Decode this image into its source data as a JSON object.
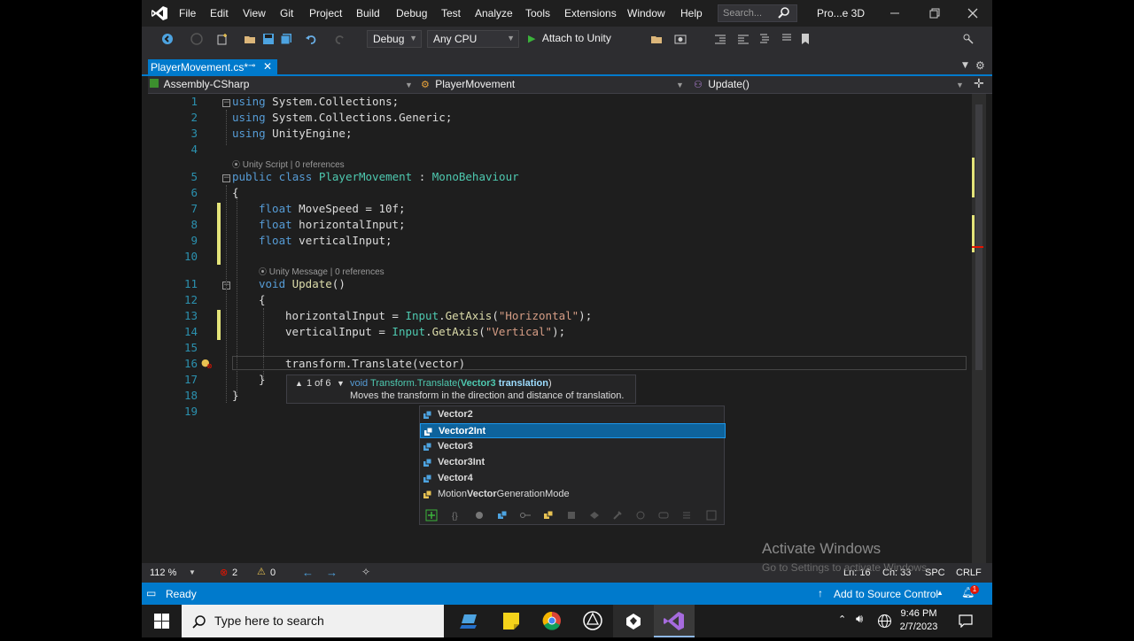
{
  "titlebar": {
    "menu": [
      "File",
      "Edit",
      "View",
      "Git",
      "Project",
      "Build",
      "Debug",
      "Test",
      "Analyze",
      "Tools",
      "Extensions",
      "Window",
      "Help"
    ],
    "search_placeholder": "Search...",
    "project_name": "Pro...e 3D"
  },
  "toolbar": {
    "config": "Debug",
    "platform": "Any CPU",
    "attach_label": "Attach to Unity"
  },
  "tab": {
    "label": "PlayerMovement.cs*"
  },
  "navbar": {
    "project": "Assembly-CSharp",
    "class": "PlayerMovement",
    "member": "Update()"
  },
  "editor": {
    "line_numbers": [
      "1",
      "2",
      "3",
      "4",
      "5",
      "6",
      "7",
      "8",
      "9",
      "10",
      "11",
      "12",
      "13",
      "14",
      "15",
      "16",
      "17",
      "18",
      "19"
    ],
    "lens_class": "Unity Script | 0 references",
    "lens_method": "Unity Message | 0 references",
    "lines": {
      "l1_kw": "using",
      "l1_rest": " System.Collections;",
      "l2_kw": "using",
      "l2_rest": " System.Collections.Generic;",
      "l3_kw": "using",
      "l3_rest": " UnityEngine;",
      "l5_kw": "public class",
      "l5_name": " PlayerMovement",
      "l5_colon": " : ",
      "l5_base": "MonoBehaviour",
      "l6": "{",
      "l7_kw": "float",
      "l7_rest": " MoveSpeed = 10f;",
      "l8_kw": "float",
      "l8_rest": " horizontalInput;",
      "l9_kw": "float",
      "l9_rest": " verticalInput;",
      "l11_kw": "void",
      "l11_name": " Update",
      "l11_rest": "()",
      "l12": "{",
      "l13_a": "horizontalInput = ",
      "l13_ty": "Input",
      "l13_b": ".",
      "l13_mt": "GetAxis",
      "l13_c": "(",
      "l13_st": "\"Horizontal\"",
      "l13_d": ");",
      "l14_a": "verticalInput = ",
      "l14_ty": "Input",
      "l14_b": ".",
      "l14_mt": "GetAxis",
      "l14_c": "(",
      "l14_st": "\"Vertical\"",
      "l14_d": ");",
      "l16": "transform.Translate(vector)",
      "l17": "}",
      "l18": "}"
    }
  },
  "signature_help": {
    "counter": "1 of 6",
    "signature_prefix": "void ",
    "signature_method": "Transform.Translate(",
    "signature_param_type": "Vector3",
    "signature_param": " translation",
    "signature_close": ")",
    "description": "Moves the transform in the direction and distance of translation."
  },
  "completion": {
    "items": [
      "Vector2",
      "Vector2Int",
      "Vector3",
      "Vector3Int",
      "Vector4"
    ],
    "selected_index": 1,
    "last_prefix": "Motion",
    "last_bold": "Vector",
    "last_suffix": "GenerationMode"
  },
  "editor_status": {
    "zoom": "112 %",
    "errors": "2",
    "warnings": "0",
    "line": "Ln: 16",
    "char": "Ch: 33",
    "spc": "SPC",
    "crlf": "CRLF"
  },
  "watermark": {
    "title": "Activate Windows",
    "subtitle": "Go to Settings to activate Windows."
  },
  "statusbar": {
    "ready": "Ready",
    "source_control": "Add to Source Control",
    "notifications": "1"
  },
  "taskbar": {
    "search_placeholder": "Type here to search",
    "time": "9:46 PM",
    "date": "2/7/2023"
  },
  "colors": {
    "accent": "#007acc",
    "keyword": "#569cd6",
    "type": "#4ec9b0",
    "string": "#d69d85",
    "method": "#dcdcaa",
    "line_number": "#2b91af"
  }
}
